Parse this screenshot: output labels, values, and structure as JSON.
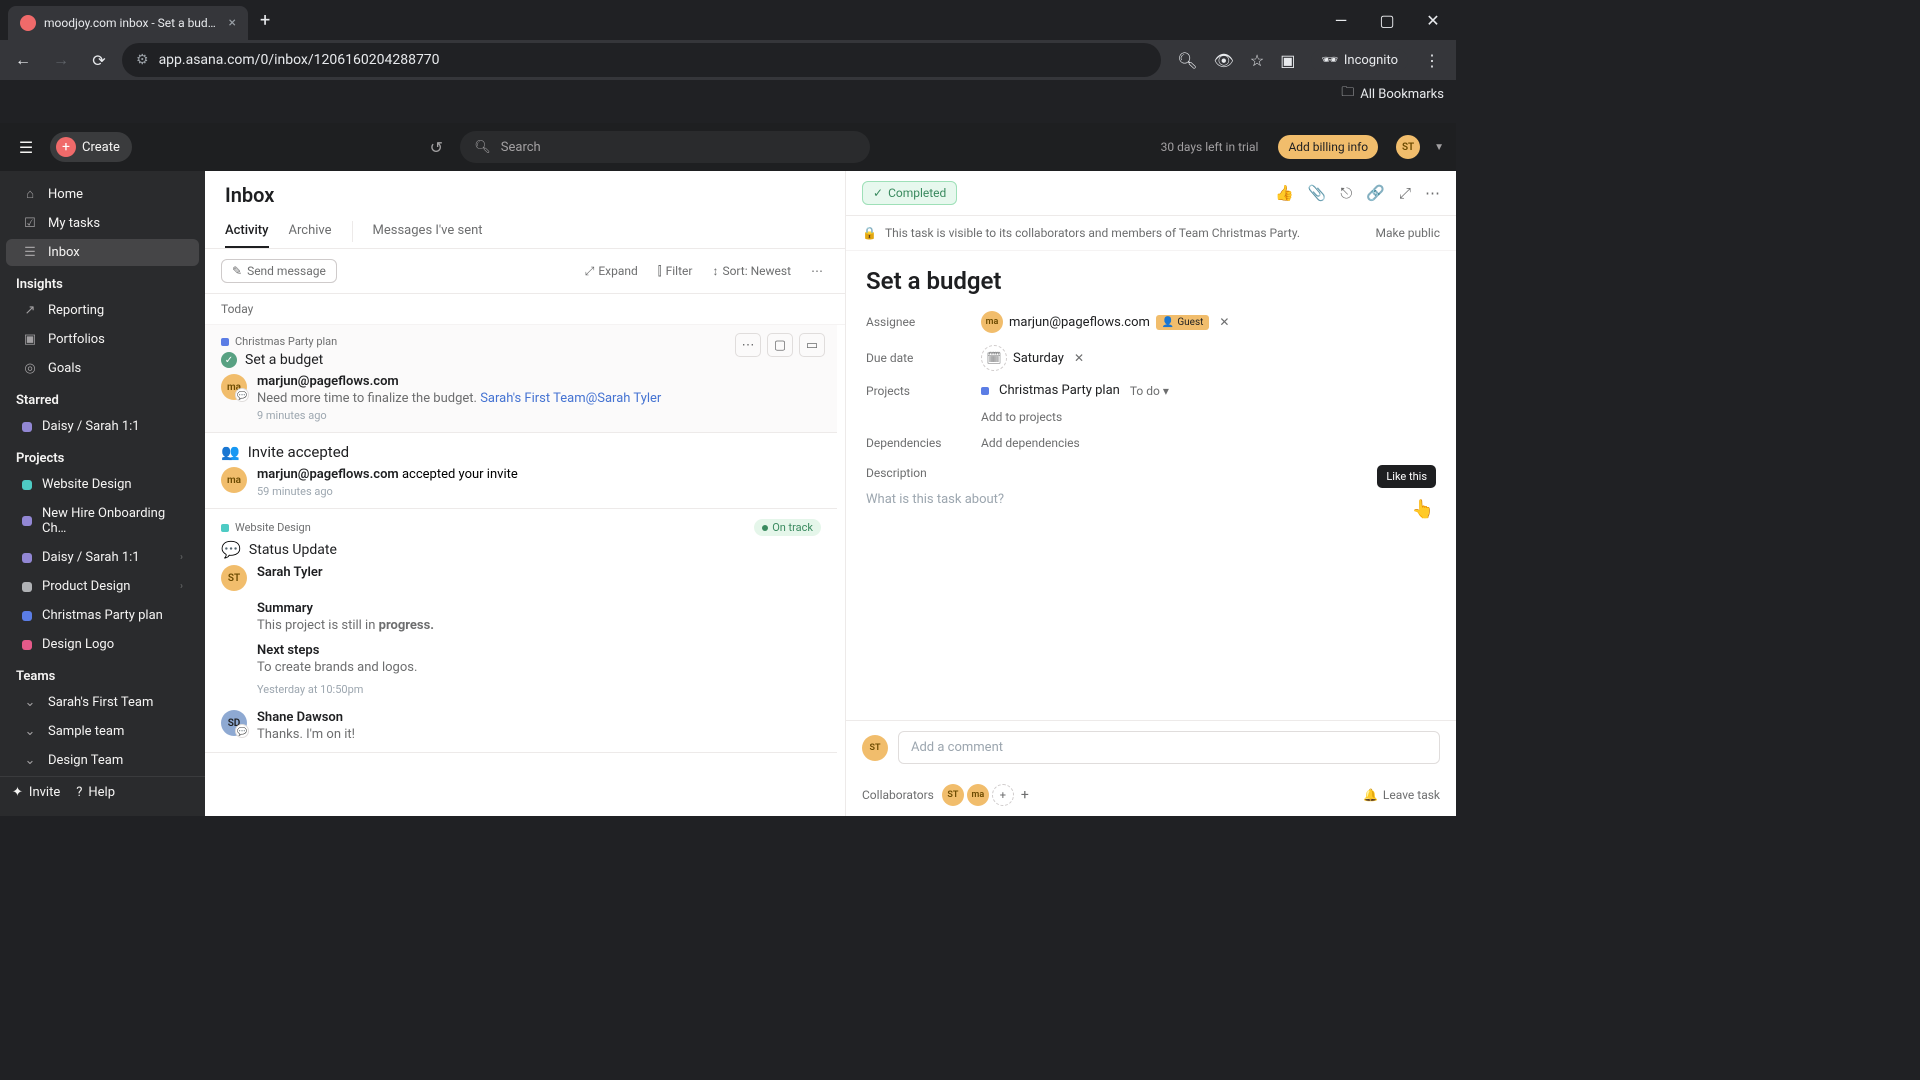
{
  "browser": {
    "tab_title": "moodjoy.com inbox - Set a bud…",
    "url": "app.asana.com/0/inbox/1206160204288770",
    "all_bookmarks": "All Bookmarks",
    "incognito": "Incognito"
  },
  "top": {
    "create": "Create",
    "search": "Search",
    "trial": "30 days left in trial",
    "billing": "Add billing info",
    "user_initials": "ST"
  },
  "sidebar": {
    "nav": [
      {
        "label": "Home",
        "icon": "⌂"
      },
      {
        "label": "My tasks",
        "icon": "☑"
      },
      {
        "label": "Inbox",
        "icon": "☰"
      }
    ],
    "insights_head": "Insights",
    "insights": [
      {
        "label": "Reporting",
        "icon": "↗"
      },
      {
        "label": "Portfolios",
        "icon": "▣"
      },
      {
        "label": "Goals",
        "icon": "◎"
      }
    ],
    "starred_head": "Starred",
    "starred": [
      {
        "label": "Daisy / Sarah 1:1",
        "color": "#9287d4"
      }
    ],
    "projects_head": "Projects",
    "projects": [
      {
        "label": "Website Design",
        "color": "#4ecbc4",
        "chev": false
      },
      {
        "label": "New Hire Onboarding Ch…",
        "color": "#9287d4",
        "chev": false
      },
      {
        "label": "Daisy / Sarah 1:1",
        "color": "#9287d4",
        "chev": true
      },
      {
        "label": "Product Design",
        "color": "#b0b2b5",
        "chev": true
      },
      {
        "label": "Christmas Party plan",
        "color": "#5b7de5",
        "chev": false
      },
      {
        "label": "Design Logo",
        "color": "#e55a8a",
        "chev": false
      }
    ],
    "teams_head": "Teams",
    "teams": [
      {
        "label": "Sarah's First Team"
      },
      {
        "label": "Sample team"
      },
      {
        "label": "Design Team"
      }
    ],
    "invite": "Invite",
    "help": "Help"
  },
  "inbox": {
    "title": "Inbox",
    "tabs": {
      "activity": "Activity",
      "archive": "Archive",
      "sent": "Messages I've sent"
    },
    "toolbar": {
      "send": "Send message",
      "expand": "Expand",
      "filter": "Filter",
      "sort": "Sort: Newest"
    },
    "section": "Today",
    "tooltip": "Like this",
    "card1": {
      "project": "Christmas Party plan",
      "task": "Set a budget",
      "author": "marjun@pageflows.com",
      "text": "Need more time to finalize the budget. ",
      "mention": "Sarah's First Team@Sarah Tyler",
      "time": "9 minutes ago"
    },
    "card2": {
      "title": "Invite accepted",
      "author": "marjun@pageflows.com",
      "suffix": " accepted your invite",
      "time": "59 minutes ago"
    },
    "card3": {
      "project": "Website Design",
      "status": "On track",
      "title": "Status Update",
      "author": "Sarah Tyler",
      "sec1": "Summary",
      "para1a": "This project is still in ",
      "para1b": "progress.",
      "sec2": "Next steps",
      "para2": "To create brands and logos.",
      "time": "Yesterday at 10:50pm",
      "author2": "Shane Dawson",
      "reply": "Thanks. I'm on it!"
    }
  },
  "detail": {
    "completed": "Completed",
    "visibility": "This task is visible to its collaborators and members of Team Christmas Party.",
    "make_public": "Make public",
    "title": "Set a budget",
    "fields": {
      "assignee_label": "Assignee",
      "assignee_name": "marjun@pageflows.com",
      "guest": "Guest",
      "due_label": "Due date",
      "due_value": "Saturday",
      "projects_label": "Projects",
      "project_name": "Christmas Party plan",
      "section": "To do",
      "add_projects": "Add to projects",
      "dep_label": "Dependencies",
      "add_dep": "Add dependencies",
      "desc_label": "Description",
      "desc_placeholder": "What is this task about?"
    },
    "comment_placeholder": "Add a comment",
    "collaborators": "Collaborators",
    "leave": "Leave task"
  }
}
